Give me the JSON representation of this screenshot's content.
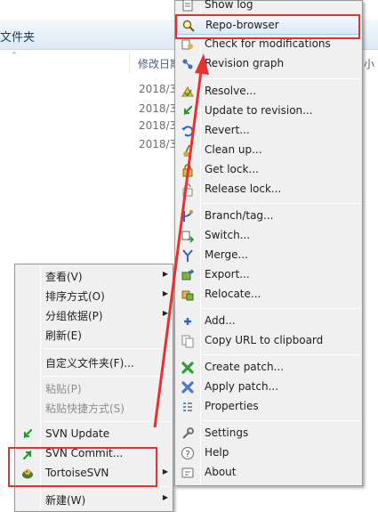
{
  "explorer": {
    "breadcrumb_label": "文件夹",
    "sort_chevron": "⌃",
    "column_date_label": "修改日期",
    "column_size_label": "小",
    "dates": [
      "2018/3",
      "2018/3",
      "2018/3",
      "2018/3"
    ]
  },
  "context_menu": {
    "items": [
      {
        "label": "查看(V)",
        "submenu": "▶"
      },
      {
        "label": "排序方式(O)",
        "submenu": "▶"
      },
      {
        "label": "分组依据(P)",
        "submenu": "▶"
      },
      {
        "label": "刷新(E)"
      },
      {
        "label": "自定义文件夹(F)..."
      },
      {
        "label": "粘贴(P)"
      },
      {
        "label": "粘贴快捷方式(S)"
      },
      {
        "label": "SVN Update"
      },
      {
        "label": "SVN Commit..."
      },
      {
        "label": "TortoiseSVN",
        "submenu": "▶"
      },
      {
        "label": "新建(W)",
        "submenu": "▶"
      }
    ]
  },
  "svn_menu": {
    "items": [
      {
        "label": "Show log"
      },
      {
        "label": "Repo-browser"
      },
      {
        "label": "Check for modifications"
      },
      {
        "label": "Revision graph"
      },
      {
        "label": "Resolve..."
      },
      {
        "label": "Update to revision..."
      },
      {
        "label": "Revert..."
      },
      {
        "label": "Clean up..."
      },
      {
        "label": "Get lock..."
      },
      {
        "label": "Release lock..."
      },
      {
        "label": "Branch/tag..."
      },
      {
        "label": "Switch..."
      },
      {
        "label": "Merge..."
      },
      {
        "label": "Export..."
      },
      {
        "label": "Relocate..."
      },
      {
        "label": "Add..."
      },
      {
        "label": "Copy URL to clipboard"
      },
      {
        "label": "Create patch..."
      },
      {
        "label": "Apply patch..."
      },
      {
        "label": "Properties"
      },
      {
        "label": "Settings"
      },
      {
        "label": "Help"
      },
      {
        "label": "About"
      }
    ]
  },
  "colors": {
    "annotation_red": "#e8302e",
    "highlight_border": "#a8c8ec",
    "menu_background": "#f0f0f0"
  }
}
